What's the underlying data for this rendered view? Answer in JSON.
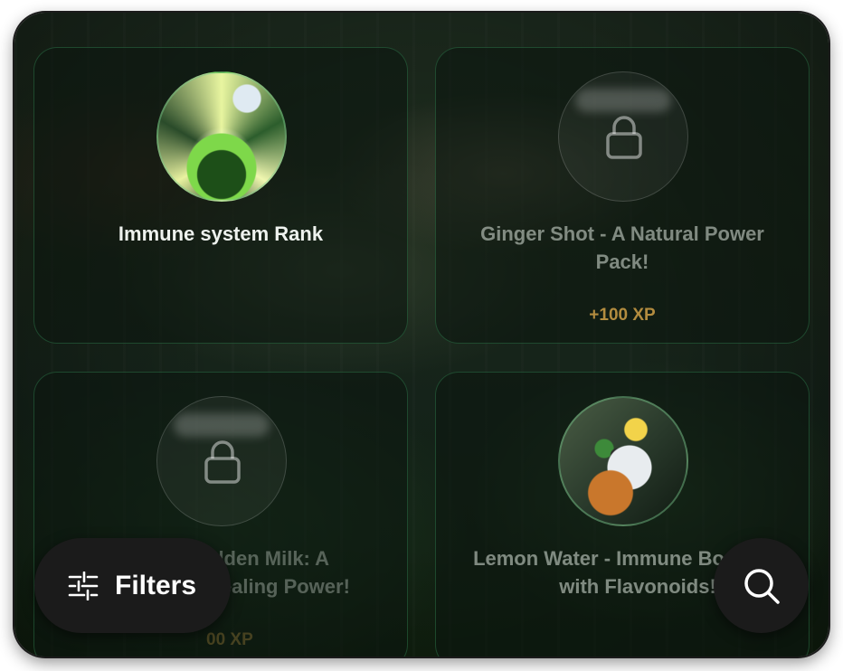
{
  "cards": [
    {
      "title": "Immune system Rank",
      "xp": "",
      "locked": false,
      "image": "immune-system-image"
    },
    {
      "title": "Ginger Shot - A Natural Power Pack!",
      "xp": "+100 XP",
      "locked": true,
      "image": "lock-icon"
    },
    {
      "title": "olden Milk: A",
      "title2": "Healing Power!",
      "xp": "00 XP",
      "locked": true,
      "image": "lock-icon"
    },
    {
      "title": "Lemon Water - Immune Bo",
      "title2": "with Flavonoids!",
      "xp": "",
      "locked": false,
      "image": "lemon-water-image"
    }
  ],
  "filters": {
    "label": "Filters",
    "icon": "sliders-icon"
  },
  "search": {
    "icon": "search-icon"
  },
  "colors": {
    "card_border": "#2f8a56",
    "xp": "#b38c3f",
    "pill": "#1b1b1b"
  }
}
